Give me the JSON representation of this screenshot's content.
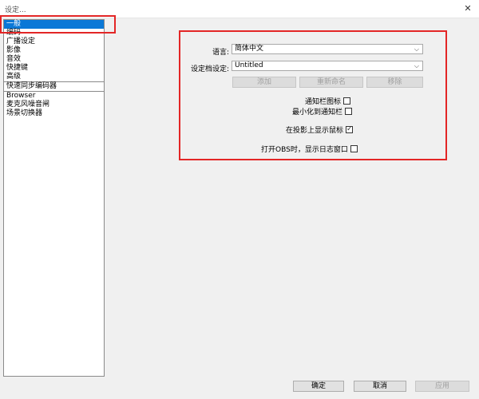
{
  "window": {
    "title": "设定...",
    "close_glyph": "✕"
  },
  "sidebar": {
    "items": [
      {
        "label": "一般"
      },
      {
        "label": "编码"
      },
      {
        "label": "广播设定"
      },
      {
        "label": "影像"
      },
      {
        "label": "音效"
      },
      {
        "label": "快捷键"
      },
      {
        "label": "高级"
      },
      {
        "label": "快速同步编码器"
      },
      {
        "label": "Browser"
      },
      {
        "label": "麦克风噪音闸"
      },
      {
        "label": "场景切换器"
      }
    ]
  },
  "general": {
    "language_label": "语言:",
    "language_value": "简体中文",
    "profile_label": "设定档设定:",
    "profile_value": "Untitled",
    "add_label": "添加",
    "rename_label": "重新命名",
    "remove_label": "移除",
    "tray_icon_label": "通知栏图标",
    "minimize_tray_label": "最小化到通知栏",
    "show_cursor_label": "在投影上显示鼠标",
    "show_log_label": "打开OBS时，显示日志窗口"
  },
  "footer": {
    "ok_label": "确定",
    "cancel_label": "取消",
    "apply_label": "应用"
  },
  "colors": {
    "accent": "#0a78d7",
    "highlight": "#e32626"
  }
}
